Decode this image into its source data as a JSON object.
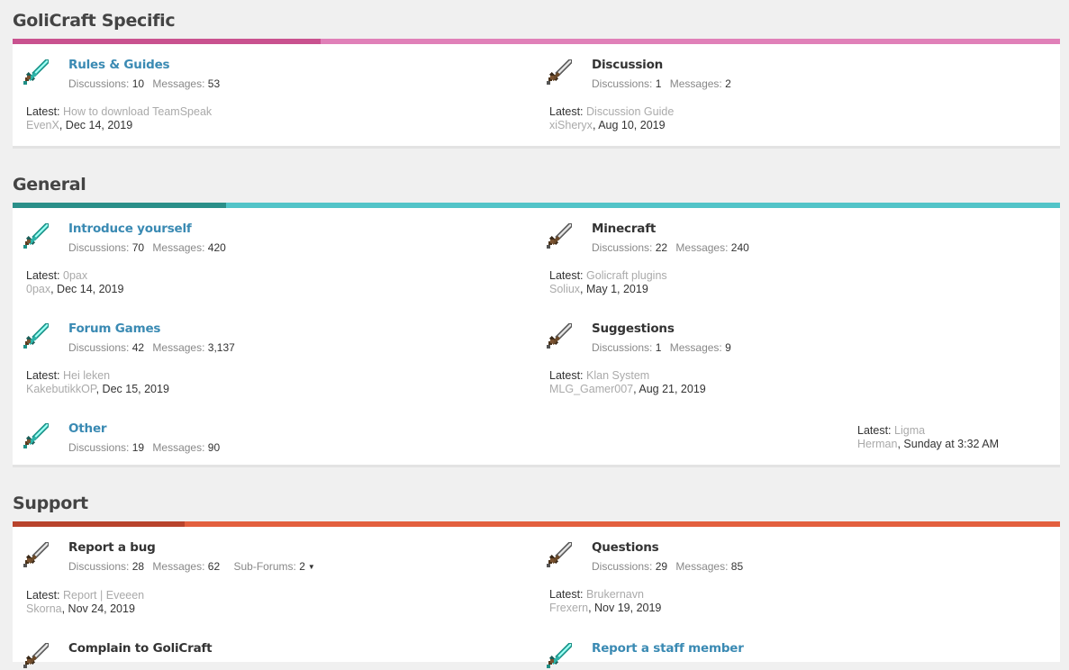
{
  "sections": [
    {
      "title": "GoliCraft Specific",
      "colors": {
        "dark": "#c9528f",
        "light": "#e080b8"
      },
      "nodes": [
        {
          "title": "Rules & Guides",
          "discussions_label": "Discussions:",
          "discussions": "10",
          "messages_label": "Messages:",
          "messages": "53",
          "latest_label": "Latest:",
          "latest_title": "How to download TeamSpeak",
          "latest_user": "EvenX",
          "latest_date": ", Dec 14, 2019",
          "icon": "diamond-sword-icon"
        },
        {
          "title": "Discussion",
          "discussions_label": "Discussions:",
          "discussions": "1",
          "messages_label": "Messages:",
          "messages": "2",
          "latest_label": "Latest:",
          "latest_title": "Discussion Guide",
          "latest_user": "xiSheryx",
          "latest_date": ", Aug 10, 2019",
          "icon": "iron-sword-icon"
        }
      ]
    },
    {
      "title": "General",
      "colors": {
        "dark": "#2a8f89",
        "light": "#52c4c8"
      },
      "nodes": [
        {
          "title": "Introduce yourself",
          "discussions_label": "Discussions:",
          "discussions": "70",
          "messages_label": "Messages:",
          "messages": "420",
          "latest_label": "Latest:",
          "latest_title": "0pax",
          "latest_user": "0pax",
          "latest_date": ", Dec 14, 2019",
          "icon": "diamond-sword-icon"
        },
        {
          "title": "Minecraft",
          "discussions_label": "Discussions:",
          "discussions": "22",
          "messages_label": "Messages:",
          "messages": "240",
          "latest_label": "Latest:",
          "latest_title": "Golicraft plugins",
          "latest_user": "Soliux",
          "latest_date": ", May 1, 2019",
          "icon": "iron-sword-icon"
        },
        {
          "title": "Forum Games",
          "discussions_label": "Discussions:",
          "discussions": "42",
          "messages_label": "Messages:",
          "messages": "3,137",
          "latest_label": "Latest:",
          "latest_title": "Hei leken",
          "latest_user": "KakebutikkOP",
          "latest_date": ", Dec 15, 2019",
          "icon": "diamond-sword-icon"
        },
        {
          "title": "Suggestions",
          "discussions_label": "Discussions:",
          "discussions": "1",
          "messages_label": "Messages:",
          "messages": "9",
          "latest_label": "Latest:",
          "latest_title": "Klan System",
          "latest_user": "MLG_Gamer007",
          "latest_date": ", Aug 21, 2019",
          "icon": "iron-sword-icon"
        },
        {
          "title": "Other",
          "discussions_label": "Discussions:",
          "discussions": "19",
          "messages_label": "Messages:",
          "messages": "90",
          "latest_label": "Latest:",
          "latest_title": "Ligma",
          "latest_user": "Herman",
          "latest_date": ", Sunday at 3:32 AM",
          "icon": "diamond-sword-icon"
        }
      ]
    },
    {
      "title": "Support",
      "colors": {
        "dark": "#b8432c",
        "light": "#e35f3e"
      },
      "nodes": [
        {
          "title": "Report a bug",
          "discussions_label": "Discussions:",
          "discussions": "28",
          "messages_label": "Messages:",
          "messages": "62",
          "subforums_label": "Sub-Forums:",
          "subforums": "2",
          "latest_label": "Latest:",
          "latest_title": "Report | Eveeen",
          "latest_user": "Skorna",
          "latest_date": ", Nov 24, 2019",
          "icon": "iron-sword-icon"
        },
        {
          "title": "Questions",
          "discussions_label": "Discussions:",
          "discussions": "29",
          "messages_label": "Messages:",
          "messages": "85",
          "latest_label": "Latest:",
          "latest_title": "Brukernavn",
          "latest_user": "Frexern",
          "latest_date": ", Nov 19, 2019",
          "icon": "iron-sword-icon"
        },
        {
          "title": "Complain to GoliCraft",
          "icon": "iron-sword-icon"
        },
        {
          "title": "Report a staff member",
          "icon": "diamond-sword-icon"
        }
      ]
    }
  ]
}
